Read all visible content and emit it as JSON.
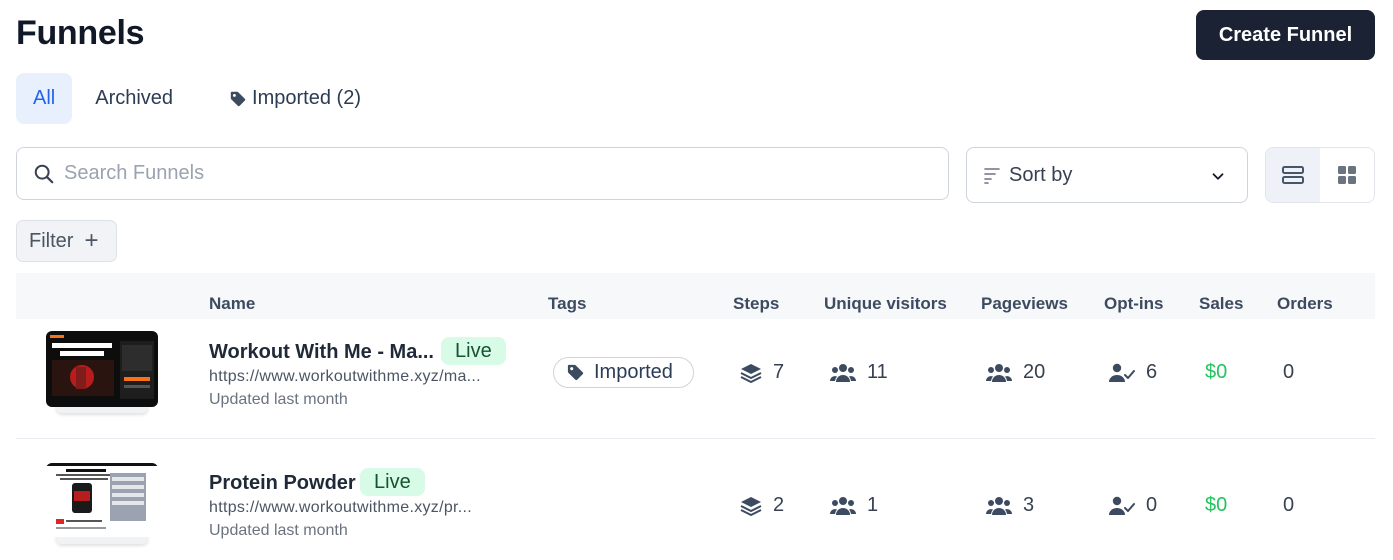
{
  "header": {
    "title": "Funnels",
    "create_label": "Create Funnel"
  },
  "tabs": [
    {
      "label": "All",
      "active": true
    },
    {
      "label": "Archived",
      "active": false
    },
    {
      "label": "Imported (2)",
      "active": false,
      "icon": "tag-icon"
    }
  ],
  "search": {
    "placeholder": "Search Funnels",
    "value": ""
  },
  "sort": {
    "label": "Sort by"
  },
  "view_toggle": {
    "active": "list"
  },
  "filter": {
    "label": "Filter",
    "icon": "plus-icon"
  },
  "table": {
    "columns": [
      "Name",
      "Tags",
      "Steps",
      "Unique visitors",
      "Pageviews",
      "Opt-ins",
      "Sales",
      "Orders"
    ],
    "rows": [
      {
        "name": "Workout With Me - Ma...",
        "status": "Live",
        "url": "https://www.workoutwithme.xyz/ma...",
        "updated": "Updated last month",
        "tag": "Imported",
        "steps": "7",
        "unique_visitors": "11",
        "pageviews": "20",
        "opt_ins": "6",
        "sales": "$0",
        "orders": "0"
      },
      {
        "name": "Protein Powder",
        "status": "Live",
        "url": "https://www.workoutwithme.xyz/pr...",
        "updated": "Updated last month",
        "tag": "",
        "steps": "2",
        "unique_visitors": "1",
        "pageviews": "3",
        "opt_ins": "0",
        "sales": "$0",
        "orders": "0"
      }
    ]
  },
  "colors": {
    "accent": "#2563eb",
    "primary_button": "#1b2233",
    "live_bg": "#d8fbe8",
    "sales": "#22c55e"
  }
}
